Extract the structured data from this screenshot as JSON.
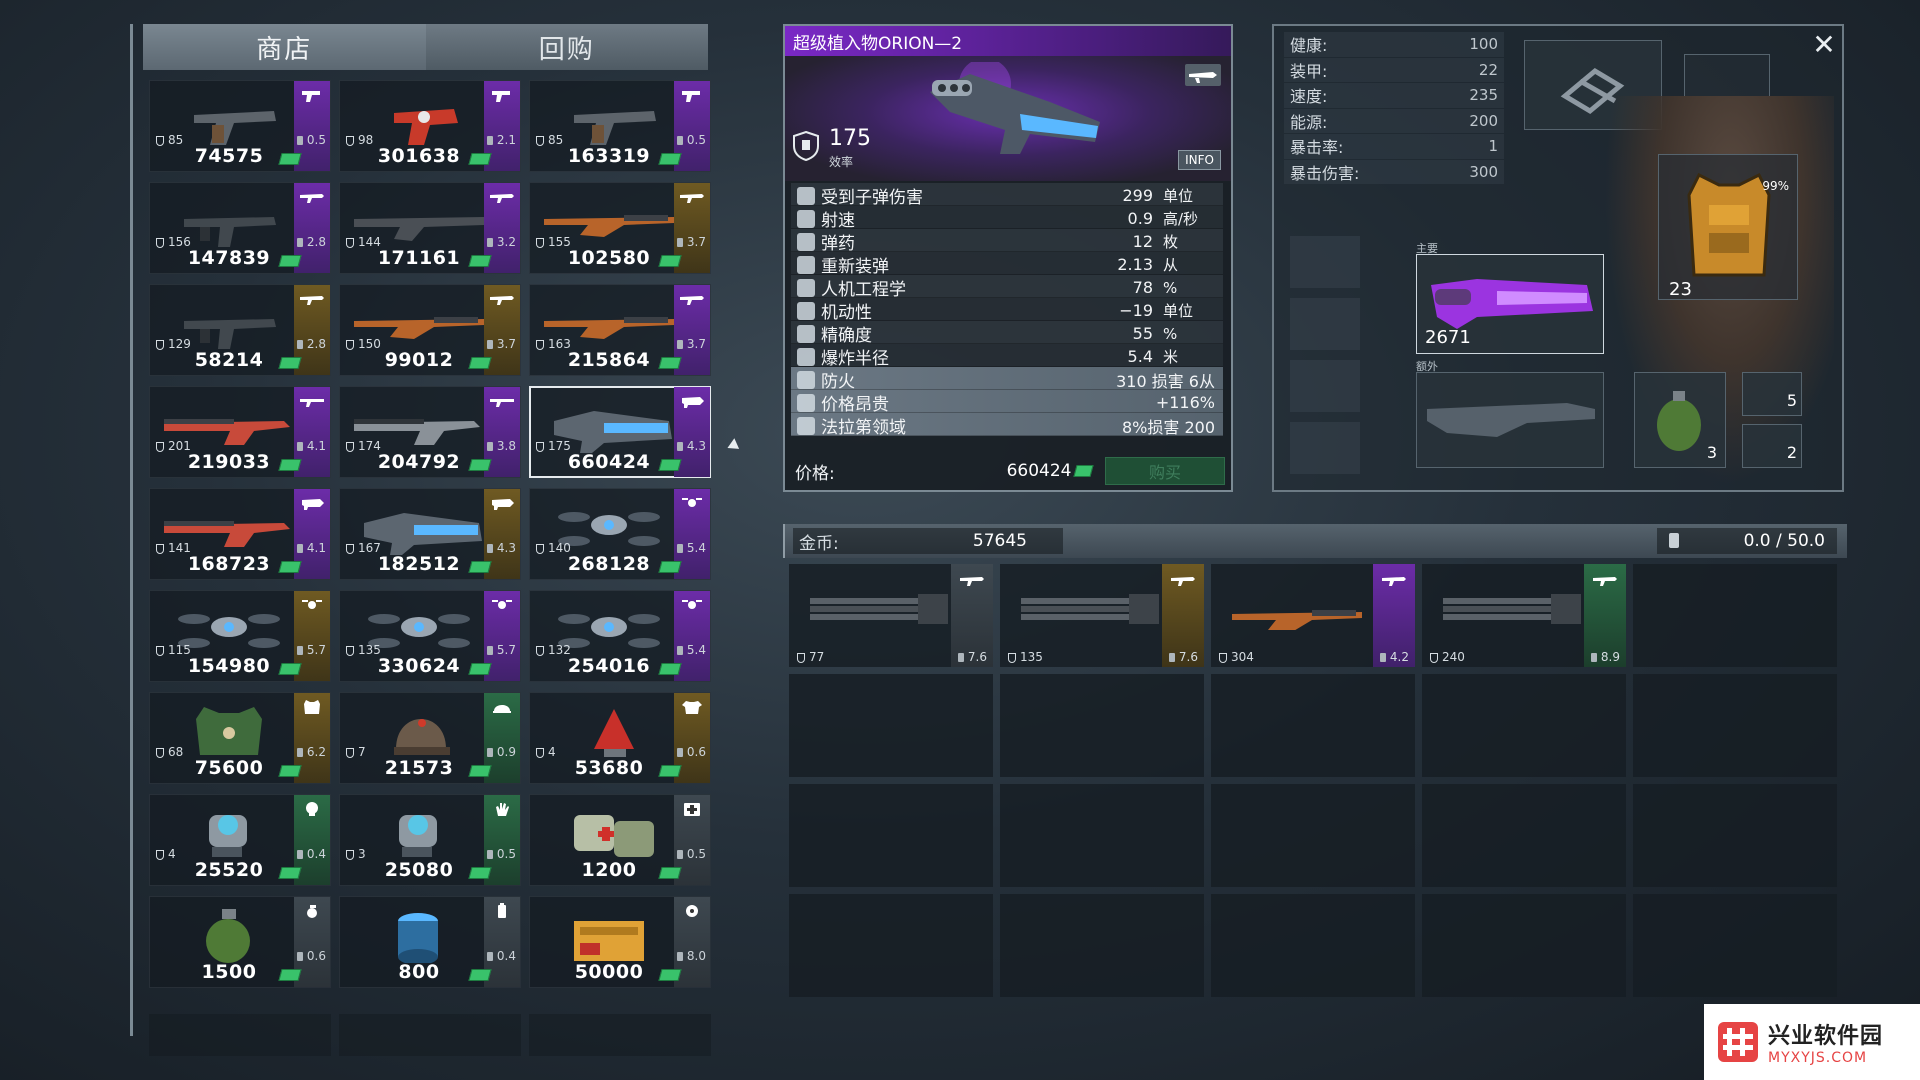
{
  "shop": {
    "tabs": [
      {
        "label": "商店"
      },
      {
        "label": "回购"
      }
    ],
    "items": [
      {
        "power": "85",
        "weight": "0.5",
        "price": "74575",
        "rarity": "purple",
        "icon": "pistol-icon",
        "art": "pistol"
      },
      {
        "power": "98",
        "weight": "2.1",
        "price": "301638",
        "rarity": "purple",
        "icon": "pistol-icon",
        "art": "red-pistol"
      },
      {
        "power": "85",
        "weight": "0.5",
        "price": "163319",
        "rarity": "purple",
        "icon": "pistol-icon",
        "art": "pistol"
      },
      {
        "power": "156",
        "weight": "2.8",
        "price": "147839",
        "rarity": "purple",
        "icon": "rifle-icon",
        "art": "smg"
      },
      {
        "power": "144",
        "weight": "3.2",
        "price": "171161",
        "rarity": "purple",
        "icon": "rifle-icon",
        "art": "rifle"
      },
      {
        "power": "155",
        "weight": "3.7",
        "price": "102580",
        "rarity": "gold",
        "icon": "rifle-icon",
        "art": "wood-rifle"
      },
      {
        "power": "129",
        "weight": "2.8",
        "price": "58214",
        "rarity": "gold",
        "icon": "rifle-icon",
        "art": "smg"
      },
      {
        "power": "150",
        "weight": "3.7",
        "price": "99012",
        "rarity": "gold",
        "icon": "rifle-icon",
        "art": "wood-rifle"
      },
      {
        "power": "163",
        "weight": "3.7",
        "price": "215864",
        "rarity": "purple",
        "icon": "rifle-icon",
        "art": "wood-rifle"
      },
      {
        "power": "201",
        "weight": "4.1",
        "price": "219033",
        "rarity": "purple",
        "icon": "shotgun-icon",
        "art": "red-shotgun"
      },
      {
        "power": "174",
        "weight": "3.8",
        "price": "204792",
        "rarity": "purple",
        "icon": "shotgun-icon",
        "art": "shotgun"
      },
      {
        "power": "175",
        "weight": "4.3",
        "price": "660424",
        "rarity": "purple",
        "icon": "heavy-icon",
        "art": "plasma",
        "selected": true
      },
      {
        "power": "141",
        "weight": "4.1",
        "price": "168723",
        "rarity": "purple",
        "icon": "heavy-icon",
        "art": "red-shotgun"
      },
      {
        "power": "167",
        "weight": "4.3",
        "price": "182512",
        "rarity": "gold",
        "icon": "heavy-icon",
        "art": "plasma"
      },
      {
        "power": "140",
        "weight": "5.4",
        "price": "268128",
        "rarity": "purple",
        "icon": "drone-icon",
        "art": "drone"
      },
      {
        "power": "115",
        "weight": "5.7",
        "price": "154980",
        "rarity": "gold",
        "icon": "drone-icon",
        "art": "drone"
      },
      {
        "power": "135",
        "weight": "5.7",
        "price": "330624",
        "rarity": "purple",
        "icon": "drone-icon",
        "art": "drone"
      },
      {
        "power": "132",
        "weight": "5.4",
        "price": "254016",
        "rarity": "purple",
        "icon": "drone-icon",
        "art": "drone"
      },
      {
        "power": "68",
        "weight": "6.2",
        "price": "75600",
        "rarity": "gold",
        "icon": "vest-icon",
        "art": "vest"
      },
      {
        "power": "7",
        "weight": "0.9",
        "price": "21573",
        "rarity": "green",
        "icon": "helmet-icon",
        "art": "hat"
      },
      {
        "power": "4",
        "weight": "0.6",
        "price": "53680",
        "rarity": "gold",
        "icon": "shirt-icon",
        "art": "red-gem"
      },
      {
        "power": "4",
        "weight": "0.4",
        "price": "25520",
        "rarity": "green",
        "icon": "head-icon",
        "art": "implant"
      },
      {
        "power": "3",
        "weight": "0.5",
        "price": "25080",
        "rarity": "green",
        "icon": "hand-icon",
        "art": "implant"
      },
      {
        "power": "",
        "weight": "0.5",
        "price": "1200",
        "rarity": "grey",
        "icon": "medkit-icon",
        "art": "medkit"
      },
      {
        "power": "",
        "weight": "0.6",
        "price": "1500",
        "rarity": "grey",
        "icon": "grenade-icon",
        "art": "grenade"
      },
      {
        "power": "",
        "weight": "0.4",
        "price": "800",
        "rarity": "grey",
        "icon": "battery-icon",
        "art": "battery"
      },
      {
        "power": "",
        "weight": "8.0",
        "price": "50000",
        "rarity": "grey",
        "icon": "gear-icon",
        "art": "crate"
      }
    ]
  },
  "detail": {
    "title": "超级植入物ORION—2",
    "power": "175",
    "power_label": "效率",
    "info_label": "INFO",
    "stats": [
      {
        "label": "受到子弹伤害",
        "value": "299",
        "unit": "单位"
      },
      {
        "label": "射速",
        "value": "0.9",
        "unit": "高/秒"
      },
      {
        "label": "弹药",
        "value": "12",
        "unit": "枚"
      },
      {
        "label": "重新装弹",
        "value": "2.13",
        "unit": "从"
      },
      {
        "label": "人机工程学",
        "value": "78",
        "unit": "%"
      },
      {
        "label": "机动性",
        "value": "−19",
        "unit": "单位"
      },
      {
        "label": "精确度",
        "value": "55",
        "unit": "%"
      },
      {
        "label": "爆炸半径",
        "value": "5.4",
        "unit": "米"
      }
    ],
    "special_stats": [
      {
        "label": "防火",
        "value": "310  损害 6从"
      },
      {
        "label": "价格昂贵",
        "value": "+116%"
      },
      {
        "label": "法拉第领域",
        "value": "8%损害  200"
      }
    ],
    "price_label": "价格:",
    "price": "660424",
    "buy_label": "购买"
  },
  "character": {
    "stats": [
      {
        "label": "健康:",
        "value": "100"
      },
      {
        "label": "装甲:",
        "value": "22"
      },
      {
        "label": "速度:",
        "value": "235"
      },
      {
        "label": "能源:",
        "value": "200"
      },
      {
        "label": "暴击率:",
        "value": "1"
      },
      {
        "label": "暴击伤害:",
        "value": "300"
      }
    ],
    "primary_label": "主要",
    "extra_label": "额外",
    "primary_power": "2671",
    "armor_power": "23",
    "armor_percent": "99%",
    "grenade_count": "3",
    "medkit_count": "5",
    "battery_count": "2",
    "close": "✕"
  },
  "inventory": {
    "gold_label": "金币:",
    "gold": "57645",
    "weight": "0.0 / 50.0",
    "items": [
      {
        "power": "77",
        "weight": "7.6",
        "rarity": "grey",
        "icon": "rifle-icon",
        "art": "minigun"
      },
      {
        "power": "135",
        "weight": "7.6",
        "rarity": "gold",
        "icon": "rifle-icon",
        "art": "minigun"
      },
      {
        "power": "304",
        "weight": "4.2",
        "rarity": "purple",
        "icon": "rifle-icon",
        "art": "wood-rifle"
      },
      {
        "power": "240",
        "weight": "8.9",
        "rarity": "green",
        "icon": "rifle-icon",
        "art": "minigun"
      }
    ]
  },
  "watermark": {
    "cn": "兴业软件园",
    "en": "MYXYJS.COM"
  },
  "colors": {
    "purple": "#6c2ca8",
    "gold": "#6f5a22",
    "green": "#2b6b46",
    "cash": "#39c26b",
    "title_purple": "#7a28c6"
  }
}
